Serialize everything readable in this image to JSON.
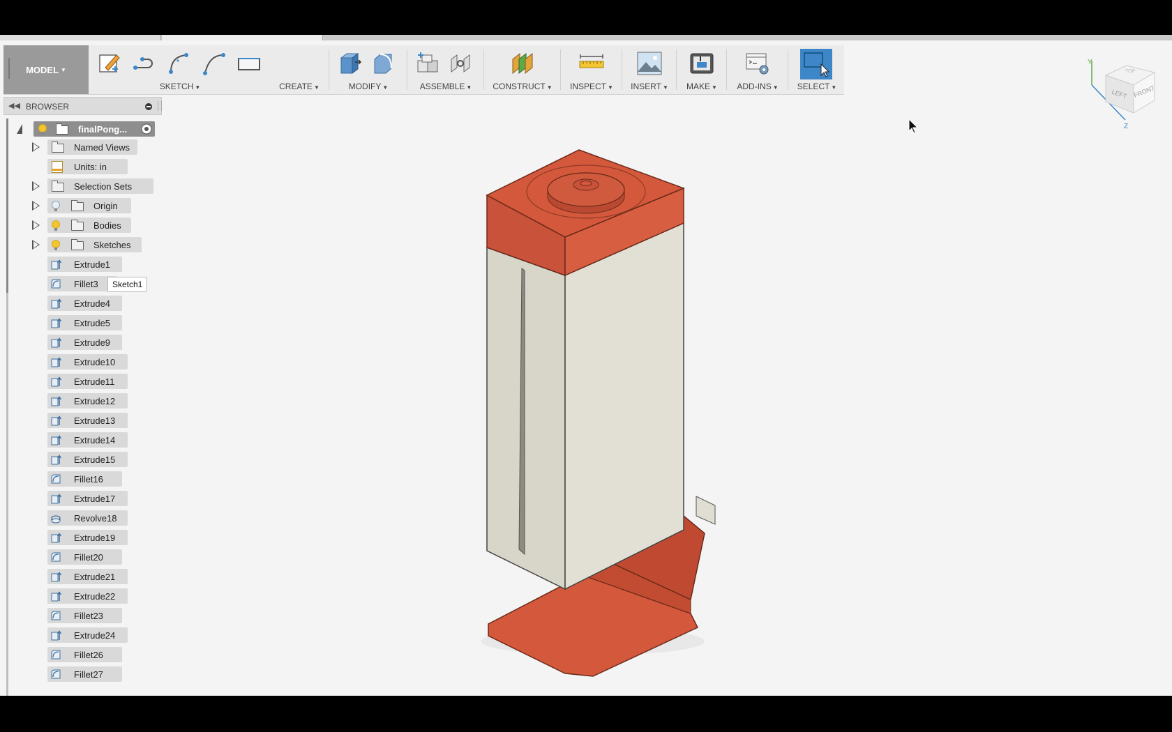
{
  "toolbar": {
    "workspace": "MODEL",
    "groups": [
      {
        "label": "SKETCH"
      },
      {
        "label": "CREATE"
      },
      {
        "label": "MODIFY"
      },
      {
        "label": "ASSEMBLE"
      },
      {
        "label": "CONSTRUCT"
      },
      {
        "label": "INSPECT"
      },
      {
        "label": "INSERT"
      },
      {
        "label": "MAKE"
      },
      {
        "label": "ADD-INS"
      },
      {
        "label": "SELECT"
      }
    ]
  },
  "browser": {
    "title": "BROWSER",
    "root": "finalPong...",
    "items": [
      {
        "label": "Named Views",
        "icon": "folder-icon"
      },
      {
        "label": "Units: in",
        "icon": "units-icon"
      },
      {
        "label": "Selection Sets",
        "icon": "folder-icon"
      },
      {
        "label": "Origin",
        "icon": "folder-icon"
      },
      {
        "label": "Bodies",
        "icon": "folder-icon"
      },
      {
        "label": "Sketches",
        "icon": "folder-icon"
      }
    ],
    "timeline": [
      {
        "label": "Extrude1",
        "type": "extrude"
      },
      {
        "label": "Fillet3",
        "type": "fillet"
      },
      {
        "label": "Extrude4",
        "type": "extrude"
      },
      {
        "label": "Extrude5",
        "type": "extrude"
      },
      {
        "label": "Extrude9",
        "type": "extrude"
      },
      {
        "label": "Extrude10",
        "type": "extrude"
      },
      {
        "label": "Extrude11",
        "type": "extrude"
      },
      {
        "label": "Extrude12",
        "type": "extrude"
      },
      {
        "label": "Extrude13",
        "type": "extrude"
      },
      {
        "label": "Extrude14",
        "type": "extrude"
      },
      {
        "label": "Extrude15",
        "type": "extrude"
      },
      {
        "label": "Fillet16",
        "type": "fillet"
      },
      {
        "label": "Extrude17",
        "type": "extrude"
      },
      {
        "label": "Revolve18",
        "type": "revolve"
      },
      {
        "label": "Extrude19",
        "type": "extrude"
      },
      {
        "label": "Fillet20",
        "type": "fillet"
      },
      {
        "label": "Extrude21",
        "type": "extrude"
      },
      {
        "label": "Extrude22",
        "type": "extrude"
      },
      {
        "label": "Fillet23",
        "type": "fillet"
      },
      {
        "label": "Extrude24",
        "type": "extrude"
      },
      {
        "label": "Fillet26",
        "type": "fillet"
      },
      {
        "label": "Fillet27",
        "type": "fillet"
      }
    ],
    "tooltip": "Sketch1"
  },
  "viewcube": {
    "left": "LEFT",
    "front": "FRONT",
    "top": "TOP",
    "axis_y": "Y",
    "axis_z": "Z"
  },
  "colors": {
    "accent_orange": "#d4583b",
    "body_beige": "#dcd9cd",
    "select_blue": "#3d86c7"
  }
}
